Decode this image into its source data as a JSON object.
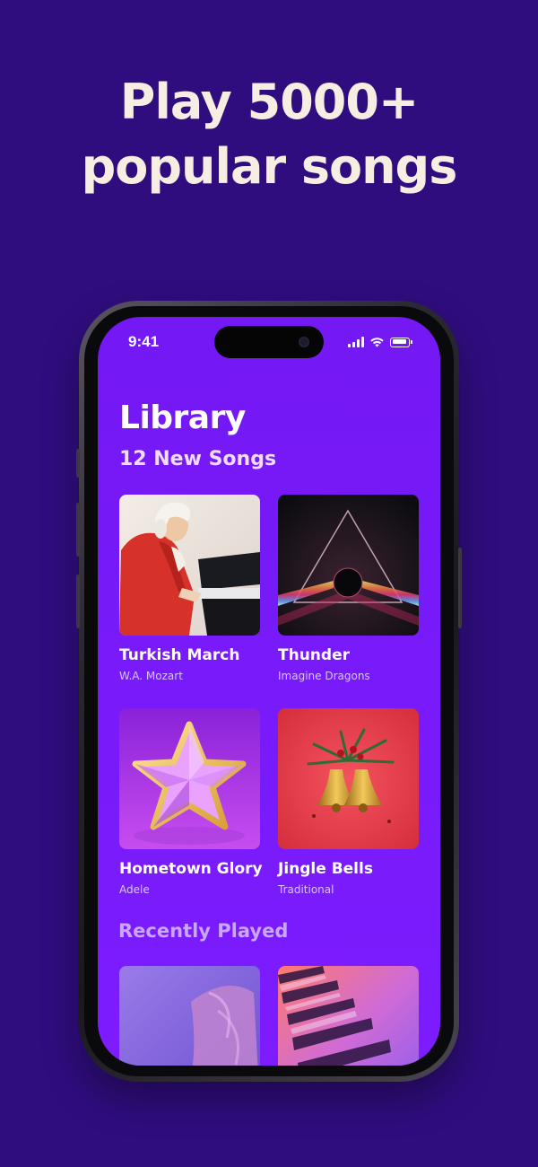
{
  "headline": {
    "line1": "Play 5000+",
    "line2": "popular songs"
  },
  "status_bar": {
    "time": "9:41"
  },
  "library": {
    "title": "Library",
    "subtitle": "12 New Songs",
    "songs": [
      {
        "title": "Turkish March",
        "artist": "W.A. Mozart",
        "artwork": "mozart-at-piano"
      },
      {
        "title": "Thunder",
        "artist": "Imagine Dragons",
        "artwork": "rainbow-prism"
      },
      {
        "title": "Hometown Glory",
        "artist": "Adele",
        "artwork": "gold-star"
      },
      {
        "title": "Jingle Bells",
        "artist": "Traditional",
        "artwork": "christmas-bells"
      }
    ]
  },
  "recently_played": {
    "title": "Recently Played",
    "items": [
      {
        "artwork": "purple-hair-portrait"
      },
      {
        "artwork": "piano-keys"
      }
    ]
  },
  "colors": {
    "page_background": "#2f0d7e",
    "screen_background": "#7c1cff",
    "headline_text": "#f6eee3"
  }
}
